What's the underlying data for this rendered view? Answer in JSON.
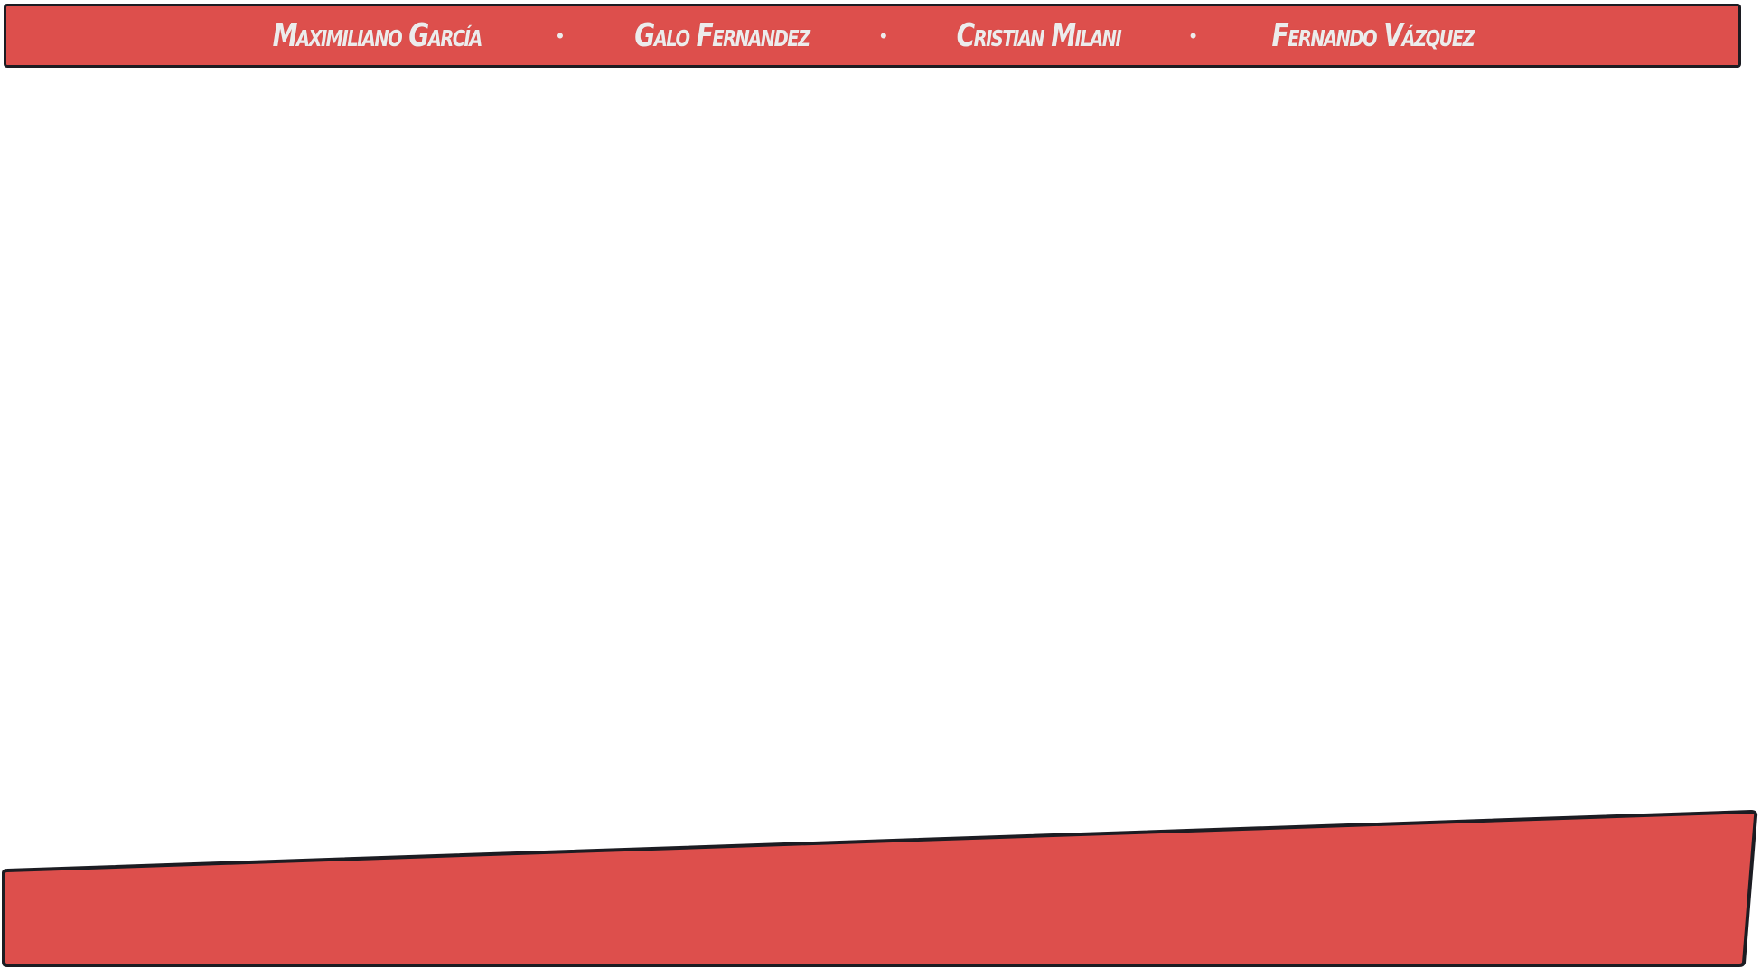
{
  "banner": {
    "names": [
      "Maximiliano García",
      "Galo Fernandez",
      "Cristian Milani",
      "Fernando Vázquez"
    ],
    "separator": "•"
  },
  "colors": {
    "banner_fill": "#dd4f4c",
    "outline": "#1c1c22",
    "name_text": "#ececec",
    "background": "#ffffff"
  }
}
